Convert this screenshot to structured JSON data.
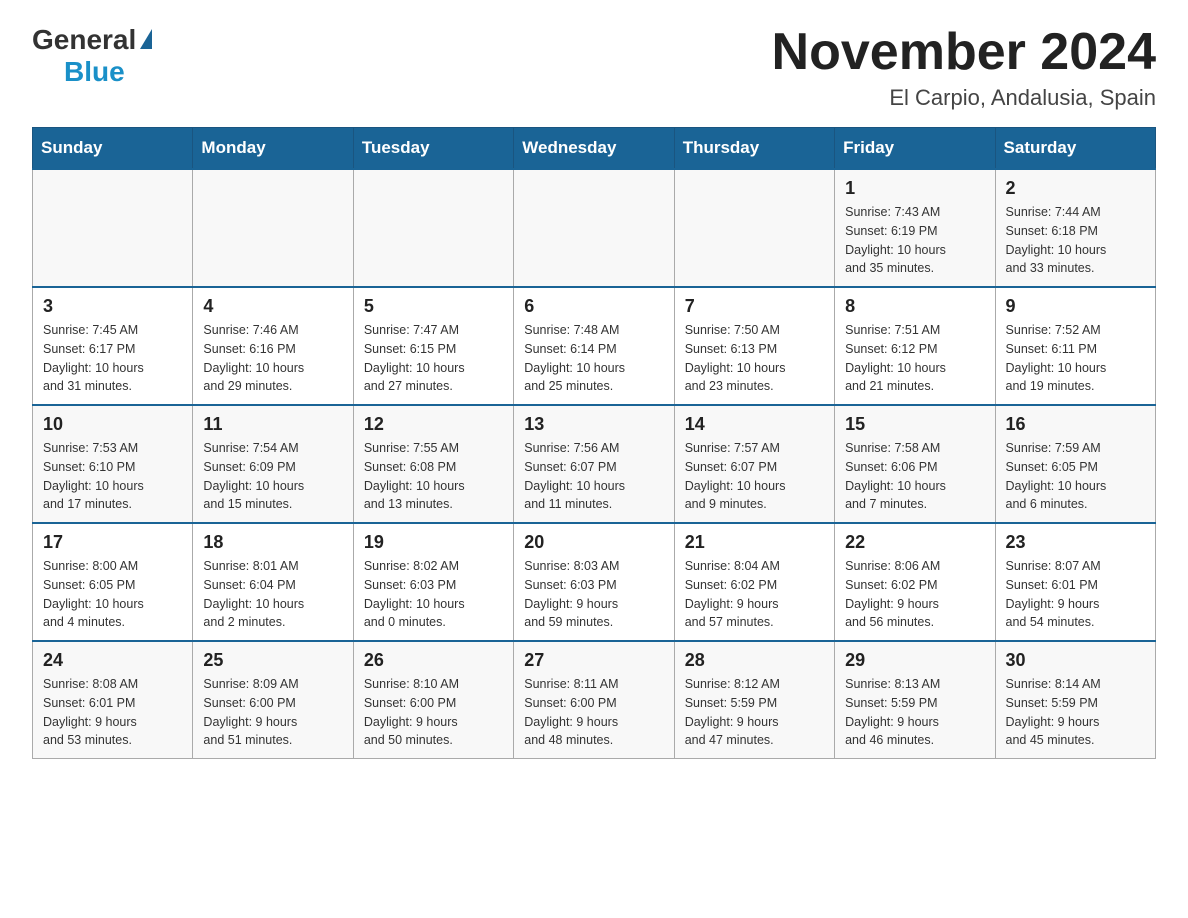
{
  "header": {
    "logo_general": "General",
    "logo_blue": "Blue",
    "title": "November 2024",
    "subtitle": "El Carpio, Andalusia, Spain"
  },
  "days_of_week": [
    "Sunday",
    "Monday",
    "Tuesday",
    "Wednesday",
    "Thursday",
    "Friday",
    "Saturday"
  ],
  "weeks": [
    [
      {
        "day": "",
        "info": ""
      },
      {
        "day": "",
        "info": ""
      },
      {
        "day": "",
        "info": ""
      },
      {
        "day": "",
        "info": ""
      },
      {
        "day": "",
        "info": ""
      },
      {
        "day": "1",
        "info": "Sunrise: 7:43 AM\nSunset: 6:19 PM\nDaylight: 10 hours\nand 35 minutes."
      },
      {
        "day": "2",
        "info": "Sunrise: 7:44 AM\nSunset: 6:18 PM\nDaylight: 10 hours\nand 33 minutes."
      }
    ],
    [
      {
        "day": "3",
        "info": "Sunrise: 7:45 AM\nSunset: 6:17 PM\nDaylight: 10 hours\nand 31 minutes."
      },
      {
        "day": "4",
        "info": "Sunrise: 7:46 AM\nSunset: 6:16 PM\nDaylight: 10 hours\nand 29 minutes."
      },
      {
        "day": "5",
        "info": "Sunrise: 7:47 AM\nSunset: 6:15 PM\nDaylight: 10 hours\nand 27 minutes."
      },
      {
        "day": "6",
        "info": "Sunrise: 7:48 AM\nSunset: 6:14 PM\nDaylight: 10 hours\nand 25 minutes."
      },
      {
        "day": "7",
        "info": "Sunrise: 7:50 AM\nSunset: 6:13 PM\nDaylight: 10 hours\nand 23 minutes."
      },
      {
        "day": "8",
        "info": "Sunrise: 7:51 AM\nSunset: 6:12 PM\nDaylight: 10 hours\nand 21 minutes."
      },
      {
        "day": "9",
        "info": "Sunrise: 7:52 AM\nSunset: 6:11 PM\nDaylight: 10 hours\nand 19 minutes."
      }
    ],
    [
      {
        "day": "10",
        "info": "Sunrise: 7:53 AM\nSunset: 6:10 PM\nDaylight: 10 hours\nand 17 minutes."
      },
      {
        "day": "11",
        "info": "Sunrise: 7:54 AM\nSunset: 6:09 PM\nDaylight: 10 hours\nand 15 minutes."
      },
      {
        "day": "12",
        "info": "Sunrise: 7:55 AM\nSunset: 6:08 PM\nDaylight: 10 hours\nand 13 minutes."
      },
      {
        "day": "13",
        "info": "Sunrise: 7:56 AM\nSunset: 6:07 PM\nDaylight: 10 hours\nand 11 minutes."
      },
      {
        "day": "14",
        "info": "Sunrise: 7:57 AM\nSunset: 6:07 PM\nDaylight: 10 hours\nand 9 minutes."
      },
      {
        "day": "15",
        "info": "Sunrise: 7:58 AM\nSunset: 6:06 PM\nDaylight: 10 hours\nand 7 minutes."
      },
      {
        "day": "16",
        "info": "Sunrise: 7:59 AM\nSunset: 6:05 PM\nDaylight: 10 hours\nand 6 minutes."
      }
    ],
    [
      {
        "day": "17",
        "info": "Sunrise: 8:00 AM\nSunset: 6:05 PM\nDaylight: 10 hours\nand 4 minutes."
      },
      {
        "day": "18",
        "info": "Sunrise: 8:01 AM\nSunset: 6:04 PM\nDaylight: 10 hours\nand 2 minutes."
      },
      {
        "day": "19",
        "info": "Sunrise: 8:02 AM\nSunset: 6:03 PM\nDaylight: 10 hours\nand 0 minutes."
      },
      {
        "day": "20",
        "info": "Sunrise: 8:03 AM\nSunset: 6:03 PM\nDaylight: 9 hours\nand 59 minutes."
      },
      {
        "day": "21",
        "info": "Sunrise: 8:04 AM\nSunset: 6:02 PM\nDaylight: 9 hours\nand 57 minutes."
      },
      {
        "day": "22",
        "info": "Sunrise: 8:06 AM\nSunset: 6:02 PM\nDaylight: 9 hours\nand 56 minutes."
      },
      {
        "day": "23",
        "info": "Sunrise: 8:07 AM\nSunset: 6:01 PM\nDaylight: 9 hours\nand 54 minutes."
      }
    ],
    [
      {
        "day": "24",
        "info": "Sunrise: 8:08 AM\nSunset: 6:01 PM\nDaylight: 9 hours\nand 53 minutes."
      },
      {
        "day": "25",
        "info": "Sunrise: 8:09 AM\nSunset: 6:00 PM\nDaylight: 9 hours\nand 51 minutes."
      },
      {
        "day": "26",
        "info": "Sunrise: 8:10 AM\nSunset: 6:00 PM\nDaylight: 9 hours\nand 50 minutes."
      },
      {
        "day": "27",
        "info": "Sunrise: 8:11 AM\nSunset: 6:00 PM\nDaylight: 9 hours\nand 48 minutes."
      },
      {
        "day": "28",
        "info": "Sunrise: 8:12 AM\nSunset: 5:59 PM\nDaylight: 9 hours\nand 47 minutes."
      },
      {
        "day": "29",
        "info": "Sunrise: 8:13 AM\nSunset: 5:59 PM\nDaylight: 9 hours\nand 46 minutes."
      },
      {
        "day": "30",
        "info": "Sunrise: 8:14 AM\nSunset: 5:59 PM\nDaylight: 9 hours\nand 45 minutes."
      }
    ]
  ]
}
